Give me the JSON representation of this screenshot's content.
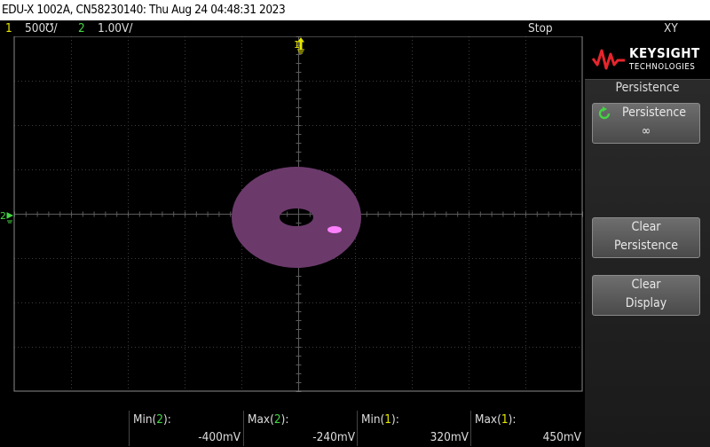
{
  "title": "EDU-X 1002A, CN58230140: Thu Aug 24 04:48:31 2023",
  "status": {
    "ch1_num": "1",
    "ch1_scale": "500℧/",
    "ch2_num": "2",
    "ch2_scale": "1.00V/",
    "run_state": "Stop",
    "mode": "XY"
  },
  "brand": {
    "line1": "KEYSIGHT",
    "line2": "TECHNOLOGIES"
  },
  "menu": {
    "title": "Persistence",
    "persistence_label": "Persistence",
    "persistence_value": "∞",
    "clear_persistence_1": "Clear",
    "clear_persistence_2": "Persistence",
    "clear_display_1": "Clear",
    "clear_display_2": "Display"
  },
  "markers": {
    "trigger": "1",
    "ch2": "2"
  },
  "measurements": [
    {
      "prefix": "Min(",
      "ch": "2",
      "suffix": "):",
      "value": "-400mV"
    },
    {
      "prefix": "Max(",
      "ch": "2",
      "suffix": "):",
      "value": "-240mV"
    },
    {
      "prefix": "Min(",
      "ch": "1",
      "suffix": "):",
      "value": "320mV"
    },
    {
      "prefix": "Max(",
      "ch": "1",
      "suffix": "):",
      "value": "450mV"
    }
  ],
  "colors": {
    "ch1": "#e6e600",
    "ch2": "#44d444",
    "trace": "#6b3a6b",
    "dot": "#ff80ff"
  }
}
